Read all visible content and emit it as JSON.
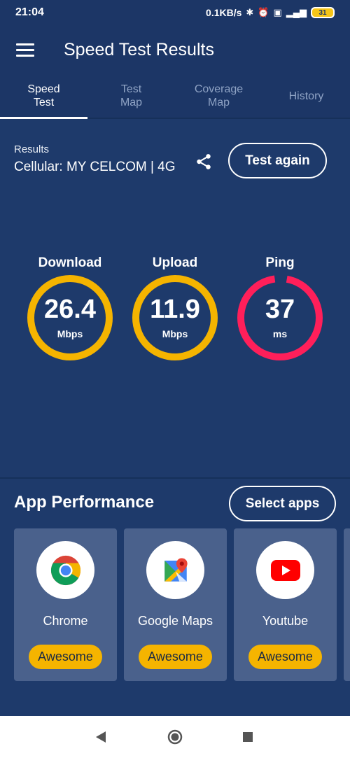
{
  "status_bar": {
    "time": "21:04",
    "speed": "0.1KB/s",
    "battery": "31",
    "icons": [
      "bluetooth-icon",
      "alarm-icon",
      "volte-icon",
      "signal-4g-icon",
      "battery-icon"
    ]
  },
  "app_bar": {
    "title": "Speed Test Results",
    "menu_icon": "hamburger-menu-icon"
  },
  "tabs": [
    {
      "label": "Speed\nTest",
      "active": true
    },
    {
      "label": "Test\nMap",
      "active": false
    },
    {
      "label": "Coverage\nMap",
      "active": false
    },
    {
      "label": "History",
      "active": false
    }
  ],
  "results": {
    "label": "Results",
    "value": "Cellular: MY CELCOM | 4G",
    "share_icon": "share-icon",
    "test_again_label": "Test again"
  },
  "gauges": [
    {
      "label": "Download",
      "value": "26.4",
      "unit": "Mbps",
      "color": "#f5b400",
      "fill": 1.0
    },
    {
      "label": "Upload",
      "value": "11.9",
      "unit": "Mbps",
      "color": "#f5b400",
      "fill": 1.0
    },
    {
      "label": "Ping",
      "value": "37",
      "unit": "ms",
      "color": "#ff1f5a",
      "fill": 0.95
    }
  ],
  "app_performance": {
    "title": "App Performance",
    "select_apps_label": "Select apps",
    "apps": [
      {
        "name": "Chrome",
        "rating": "Awesome",
        "icon": "chrome-icon"
      },
      {
        "name": "Google Maps",
        "rating": "Awesome",
        "icon": "google-maps-icon"
      },
      {
        "name": "Youtube",
        "rating": "Awesome",
        "icon": "youtube-icon"
      }
    ]
  },
  "colors": {
    "background": "#1e3a6b",
    "accent_yellow": "#f5b400",
    "accent_pink": "#ff1f5a",
    "card": "#4a618c"
  },
  "nav_bar": {
    "icons": [
      "back-icon",
      "home-icon",
      "recents-icon"
    ]
  }
}
